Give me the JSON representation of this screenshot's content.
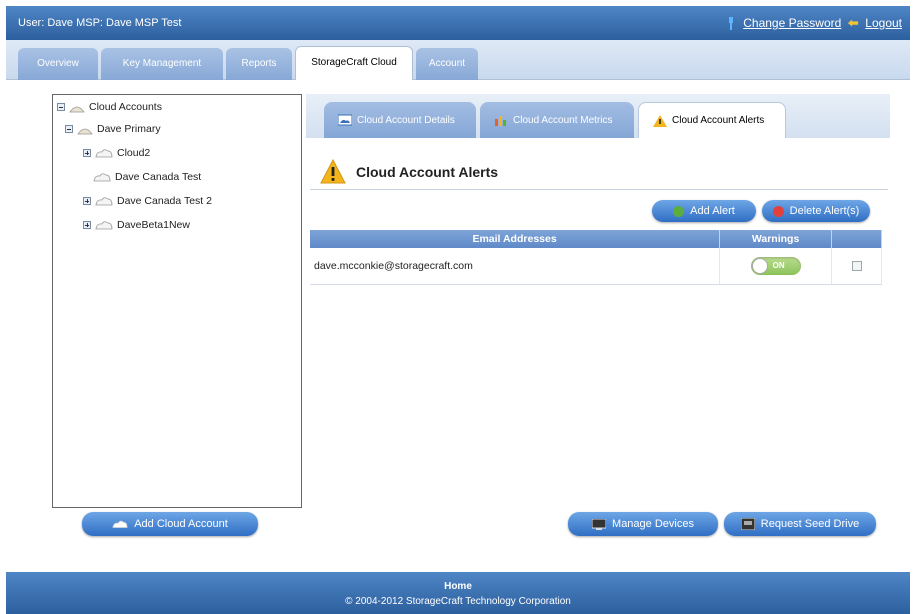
{
  "header": {
    "user_label": "User: Dave   MSP: Dave MSP Test",
    "change_password": "Change Password",
    "logout": "Logout"
  },
  "main_tabs": [
    {
      "label": "Overview"
    },
    {
      "label": "Key Management"
    },
    {
      "label": "Reports"
    },
    {
      "label": "StorageCraft Cloud"
    },
    {
      "label": "Account"
    }
  ],
  "tree": {
    "root": "Cloud Accounts",
    "primary": "Dave Primary",
    "items": [
      "Cloud2",
      "Dave Canada Test",
      "Dave Canada Test 2",
      "DaveBeta1New"
    ]
  },
  "sub_tabs": [
    {
      "label": "Cloud Account Details"
    },
    {
      "label": "Cloud Account Metrics"
    },
    {
      "label": "Cloud Account Alerts"
    }
  ],
  "alerts": {
    "title": "Cloud Account Alerts",
    "add_alert": "Add Alert",
    "delete_alerts": "Delete Alert(s)",
    "columns": [
      "Email Addresses",
      "Warnings",
      ""
    ],
    "rows": [
      {
        "email": "dave.mcconkie@storagecraft.com",
        "warning": "ON"
      }
    ]
  },
  "buttons": {
    "add_cloud_account": "Add Cloud Account",
    "manage_devices": "Manage Devices",
    "request_seed_drive": "Request Seed Drive"
  },
  "footer": {
    "home": "Home",
    "copyright": "© 2004-2012 StorageCraft Technology Corporation"
  },
  "colors": {
    "header_blue": "#2c5f9e",
    "button_blue": "#2f6ec4",
    "toggle_green": "#8cc25a",
    "alert_yellow": "#f2b51d"
  }
}
